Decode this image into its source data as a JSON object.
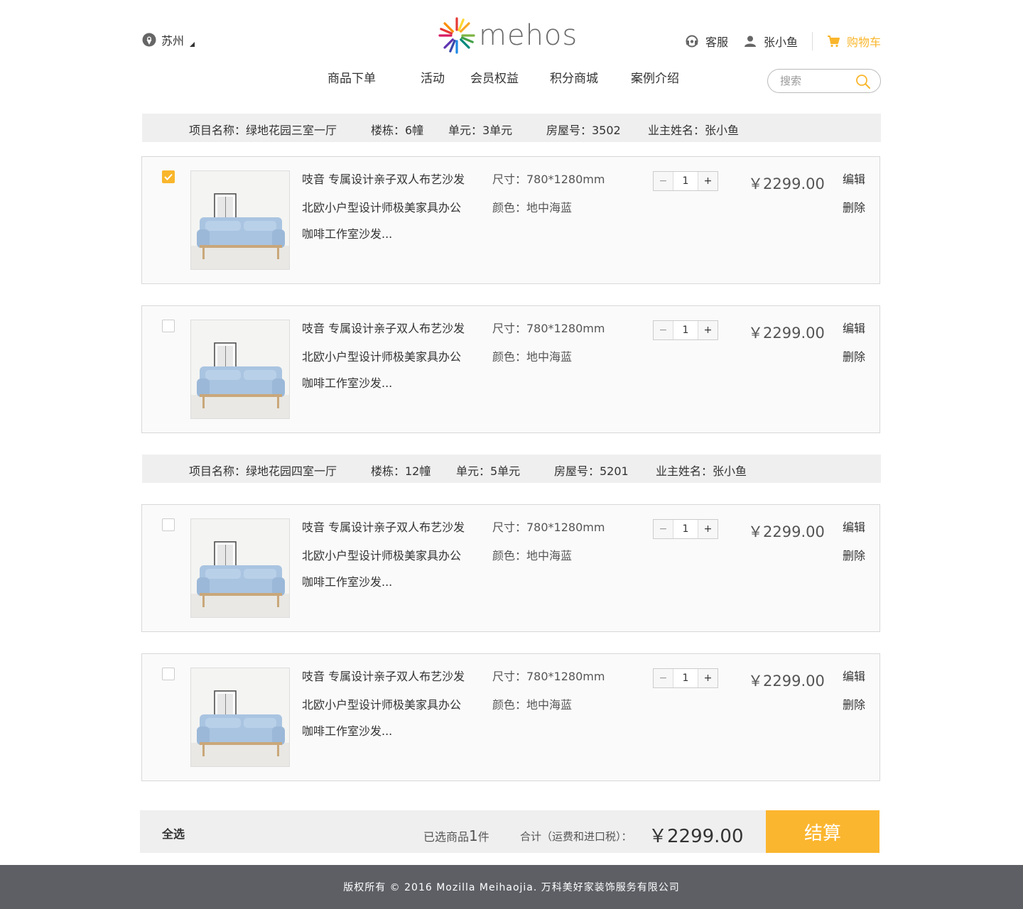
{
  "header": {
    "city": "苏州",
    "logo_text": "mehos",
    "service": "客服",
    "username": "张小鱼",
    "cart": "购物车",
    "search_placeholder": "搜索"
  },
  "nav": [
    "商品下单",
    "活动",
    "会员权益",
    "积分商城",
    "案例介绍"
  ],
  "projects": [
    {
      "name_label": "项目名称：绿地花园三室一厅",
      "building_label": "楼栋：6幢",
      "unit_label": "单元：3单元",
      "room_label": "房屋号：3502",
      "owner_label": "业主姓名：张小鱼",
      "items": [
        {
          "checked": true,
          "title1": "吱音 专属设计亲子双人布艺沙发",
          "title2": "北欧小户型设计师极美家具办公",
          "title3": "咖啡工作室沙发...",
          "size": "尺寸：780*1280mm",
          "color": "颜色：地中海蓝",
          "qty": "1",
          "price": "￥2299.00",
          "edit": "编辑",
          "delete": "删除"
        },
        {
          "checked": false,
          "title1": "吱音 专属设计亲子双人布艺沙发",
          "title2": "北欧小户型设计师极美家具办公",
          "title3": "咖啡工作室沙发...",
          "size": "尺寸：780*1280mm",
          "color": "颜色：地中海蓝",
          "qty": "1",
          "price": "￥2299.00",
          "edit": "编辑",
          "delete": "删除"
        }
      ]
    },
    {
      "name_label": "项目名称：绿地花园四室一厅",
      "building_label": "楼栋：12幢",
      "unit_label": "单元：5单元",
      "room_label": "房屋号：5201",
      "owner_label": "业主姓名：张小鱼",
      "items": [
        {
          "checked": false,
          "title1": "吱音 专属设计亲子双人布艺沙发",
          "title2": "北欧小户型设计师极美家具办公",
          "title3": "咖啡工作室沙发...",
          "size": "尺寸：780*1280mm",
          "color": "颜色：地中海蓝",
          "qty": "1",
          "price": "￥2299.00",
          "edit": "编辑",
          "delete": "删除"
        },
        {
          "checked": false,
          "title1": "吱音 专属设计亲子双人布艺沙发",
          "title2": "北欧小户型设计师极美家具办公",
          "title3": "咖啡工作室沙发...",
          "size": "尺寸：780*1280mm",
          "color": "颜色：地中海蓝",
          "qty": "1",
          "price": "￥2299.00",
          "edit": "编辑",
          "delete": "删除"
        }
      ]
    }
  ],
  "qty_minus": "−",
  "qty_plus": "+",
  "checkout": {
    "select_all": "全选",
    "selected_prefix": "已选商品",
    "selected_count": "1",
    "selected_suffix": "件",
    "total_label": "合计（运费和进口税）：",
    "total_price": "￥2299.00",
    "submit": "结算"
  },
  "footer": "版权所有 © 2016 Mozilla Meihaojia. 万科美好家装饰服务有限公司",
  "colors": {
    "accent": "#f9b62c",
    "footer_bg": "#5d5f65",
    "bar_bg": "#efefef"
  }
}
